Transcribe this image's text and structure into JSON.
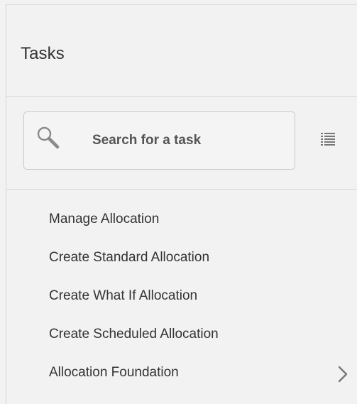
{
  "panel": {
    "title": "Tasks"
  },
  "search": {
    "placeholder": "Search for a task",
    "value": "",
    "icon": "search-icon",
    "view_toggle_icon": "list-view-icon"
  },
  "tasks": {
    "items": [
      {
        "label": "Manage Allocation"
      },
      {
        "label": "Create Standard Allocation"
      },
      {
        "label": "Create What If Allocation"
      },
      {
        "label": "Create Scheduled Allocation"
      },
      {
        "label": "Allocation Foundation",
        "has_submenu": true,
        "icon": "chevron-right-icon"
      }
    ]
  },
  "colors": {
    "panel_background": "#f2f2f2",
    "text": "#333333",
    "divider": "#d6d6d6",
    "search_border": "#c8c8c8"
  }
}
